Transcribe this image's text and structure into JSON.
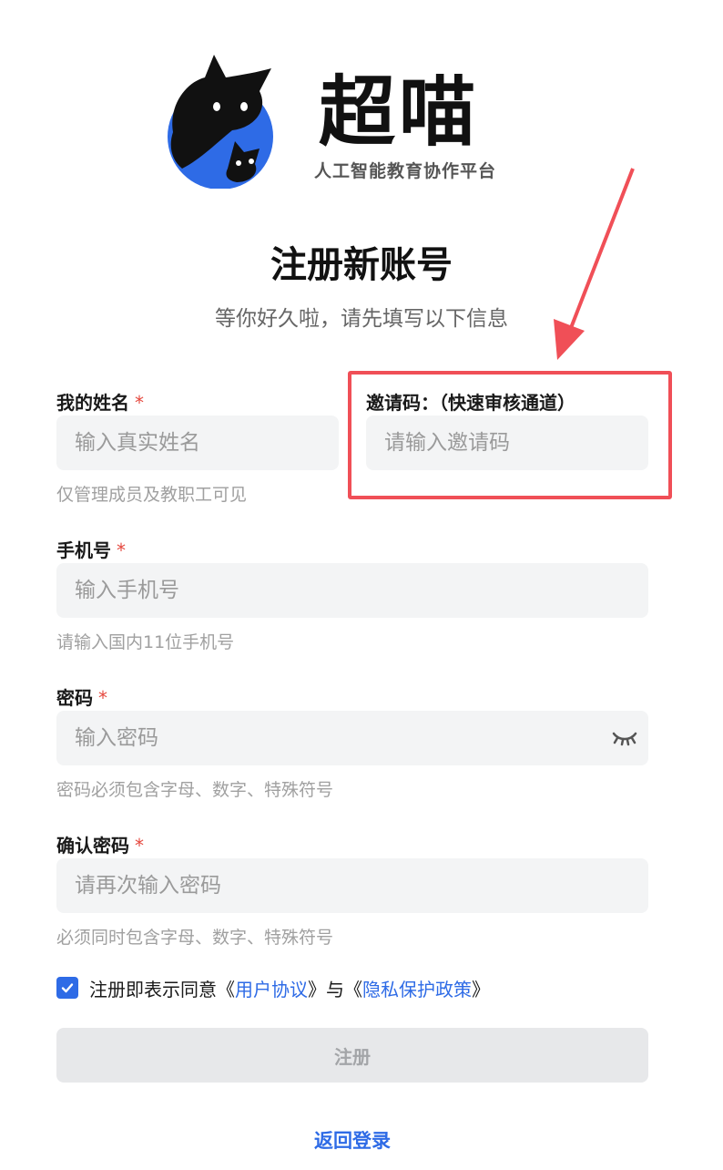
{
  "brand": {
    "name": "超喵",
    "tagline": "人工智能教育协作平台"
  },
  "page": {
    "title": "注册新账号",
    "subtitle": "等你好久啦，请先填写以下信息"
  },
  "form": {
    "name": {
      "label": "我的姓名",
      "required_mark": "*",
      "placeholder": "输入真实姓名",
      "hint": "仅管理成员及教职工可见"
    },
    "invite": {
      "label": "邀请码：（快速审核通道）",
      "placeholder": "请输入邀请码"
    },
    "phone": {
      "label": "手机号",
      "required_mark": "*",
      "placeholder": "输入手机号",
      "hint": "请输入国内11位手机号"
    },
    "password": {
      "label": "密码",
      "required_mark": "*",
      "placeholder": "输入密码",
      "hint": "密码必须包含字母、数字、特殊符号",
      "toggle_icon": "eye-closed-icon"
    },
    "confirm": {
      "label": "确认密码",
      "required_mark": "*",
      "placeholder": "请再次输入密码",
      "hint": "必须同时包含字母、数字、特殊符号"
    },
    "agreement": {
      "checked": true,
      "prefix": "注册即表示同意《",
      "user_agreement": "用户协议",
      "middle": "》与《",
      "privacy_policy": "隐私保护政策",
      "suffix": "》"
    },
    "submit_label": "注册",
    "back_label": "返回登录"
  },
  "colors": {
    "accent": "#2e6be6",
    "required": "#e5483e",
    "highlight": "#f04f57",
    "input_bg": "#f3f4f5"
  }
}
